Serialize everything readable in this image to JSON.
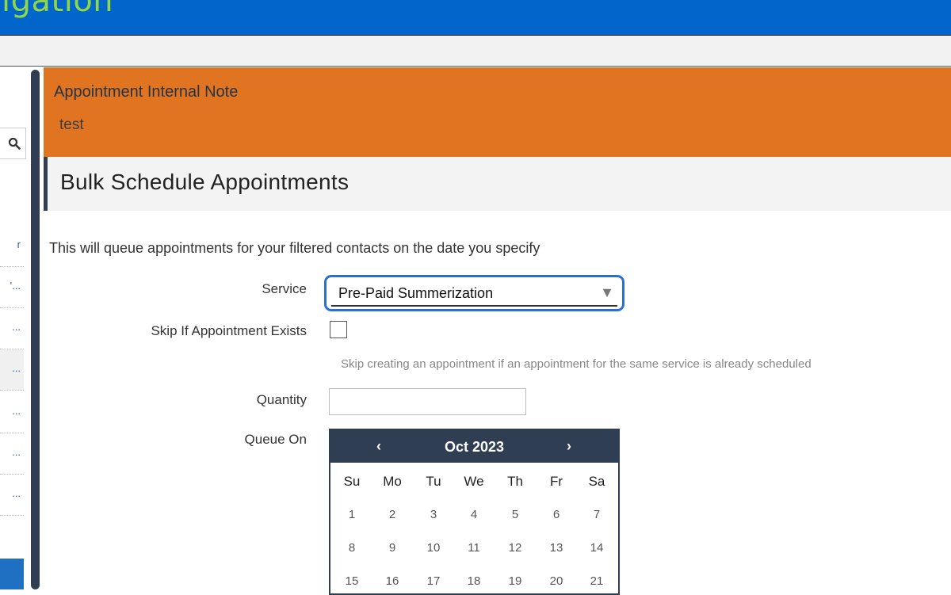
{
  "app": {
    "brand_partial": "igation"
  },
  "note": {
    "title": "Appointment Internal Note",
    "body": "test"
  },
  "page": {
    "title": "Bulk Schedule Appointments"
  },
  "form": {
    "intro": "This will queue appointments for your filtered contacts on the date you specify",
    "service_label": "Service",
    "service_value": "Pre-Paid Summerization",
    "skip_label": "Skip If Appointment Exists",
    "skip_checked": false,
    "skip_help": "Skip creating an appointment if an appointment for the same service is already scheduled",
    "quantity_label": "Quantity",
    "quantity_value": "",
    "queue_label": "Queue On"
  },
  "calendar": {
    "month_label": "Oct 2023",
    "prev": "‹",
    "next": "›",
    "weekdays": [
      "Su",
      "Mo",
      "Tu",
      "We",
      "Th",
      "Fr",
      "Sa"
    ],
    "weeks": [
      [
        "1",
        "2",
        "3",
        "4",
        "5",
        "6",
        "7"
      ],
      [
        "8",
        "9",
        "10",
        "11",
        "12",
        "13",
        "14"
      ],
      [
        "15",
        "16",
        "17",
        "18",
        "19",
        "20",
        "21"
      ]
    ]
  },
  "sidebar": {
    "items": [
      "r",
      "'...",
      "...",
      "...",
      "...",
      "...",
      "..."
    ]
  },
  "icons": {
    "search": "search-icon",
    "dropdown": "dropdown-arrow-icon"
  },
  "colors": {
    "topbar": "#0066cc",
    "note_bg": "#e07420",
    "focus": "#2a6edb",
    "calendar_header": "#2f3e52"
  }
}
